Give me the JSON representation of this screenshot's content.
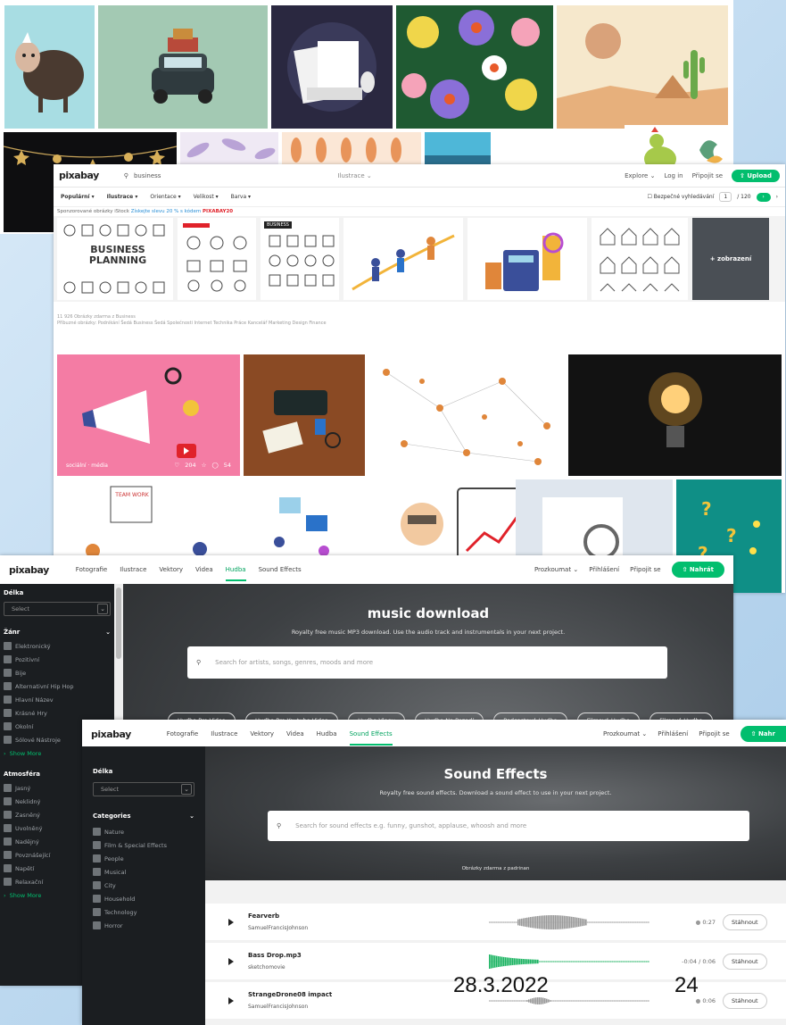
{
  "layer2": {
    "logo": "pixabay",
    "search_value": "business",
    "search_type": "Ilustrace",
    "nav": [
      "Explore",
      "Log in",
      "Připojit se"
    ],
    "upload": "Upload",
    "filters": [
      "Populární",
      "Ilustrace",
      "Orientace",
      "Velikost",
      "Barva"
    ],
    "safe_search": "Bezpečné vyhledávání",
    "page_current": "1",
    "page_total": "/ 120",
    "sponsored_text": "Sponzorované obrázky iStock",
    "sponsored_link": "Získejte slevu 20 % s kódem",
    "sponsored_code": "PIXABAY20",
    "istock_more": "+ zobrazení",
    "istock_planning": "BUSINESS PLANNING",
    "istock_business": "BUSINESS",
    "stats_line1": "11 926 Obrázky zdarma z Business",
    "stats_line2": "Příbuzné obrázky:  Podnikání Šedá Business Šedá Společnosti Internet Technika Práce Kancelář Marketing Design Finance",
    "card1_tag": "sociální · média",
    "card1_likes": "204",
    "card1_comments": "54",
    "team_board": "TEAM WORK"
  },
  "layer3": {
    "logo": "pixabay",
    "nav": [
      "Fotografie",
      "Ilustrace",
      "Vektory",
      "Videa",
      "Hudba",
      "Sound Effects"
    ],
    "active_nav": "Hudba",
    "right": [
      "Prozkoumat",
      "Přihlášení",
      "Připojit se"
    ],
    "upload": "Nahrát",
    "sidebar": {
      "delka_label": "Délka",
      "delka_select": "Select",
      "zanr_label": "Žánr",
      "zanr_items": [
        "Elektronický",
        "Pozitivní",
        "Bije",
        "Alternativní Hip Hop",
        "Hlavní Název",
        "Krásné Hry",
        "Okolní",
        "Sólové Nástroje"
      ],
      "show_more": "Show More",
      "atmosfera_label": "Atmosféra",
      "atmosfera_items": [
        "Jasný",
        "Neklidný",
        "Zasněný",
        "Uvolněný",
        "Nadějný",
        "Povznášející",
        "Napětí",
        "Relaxační"
      ],
      "show_more2": "Show More"
    },
    "hero_title": "music download",
    "hero_sub": "Royalty free music MP3 download. Use the audio track and instrumentals in your next project.",
    "search_placeholder": "Search for artists, songs, genres, moods and more",
    "pills": [
      "Hudba Pro Videa",
      "Hudba Pro Youtube Videa",
      "Hudba Vlogu",
      "Hudba Na Pozadí",
      "Podcastová Hudba",
      "Filmová Hudba",
      "Filmová Hudba"
    ]
  },
  "layer4": {
    "logo": "pixabay",
    "nav": [
      "Fotografie",
      "Ilustrace",
      "Vektory",
      "Videa",
      "Hudba",
      "Sound Effects"
    ],
    "active_nav": "Sound Effects",
    "right": [
      "Prozkoumat",
      "Přihlášení",
      "Připojit se"
    ],
    "upload": "Nahr",
    "sidebar": {
      "delka_label": "Délka",
      "delka_select": "Select",
      "categories_label": "Categories",
      "categories": [
        "Nature",
        "Film & Special Effects",
        "People",
        "Musical",
        "City",
        "Household",
        "Technology",
        "Horror"
      ]
    },
    "hero_title": "Sound Effects",
    "hero_sub": "Royalty free sound effects. Download a sound effect to use in your next project.",
    "search_placeholder": "Search for sound effects e.g. funny, gunshot, applause, whoosh and more",
    "hero_credit": "Obrázky zdarma z padrinan",
    "tracks": [
      {
        "title": "Fearverb",
        "author": "SamuelFrancisJohnson",
        "duration": "0:27",
        "download": "Stáhnout",
        "wave_color": "#9a9a9a"
      },
      {
        "title": "Bass Drop.mp3",
        "author": "sketchomovie",
        "duration": "-0:04 / 0:06",
        "download": "Stáhnout",
        "wave_color": "#1bb462"
      },
      {
        "title": "StrangeDrone08 impact",
        "author": "SamuelFrancisJohnson",
        "duration": "0:06",
        "download": "Stáhnout",
        "wave_color": "#9a9a9a"
      }
    ]
  },
  "slide_date": "28.3.2022",
  "slide_number": "24",
  "colors": {
    "accent_green": "#02be6e",
    "dark_sidebar": "#1b1e21"
  }
}
